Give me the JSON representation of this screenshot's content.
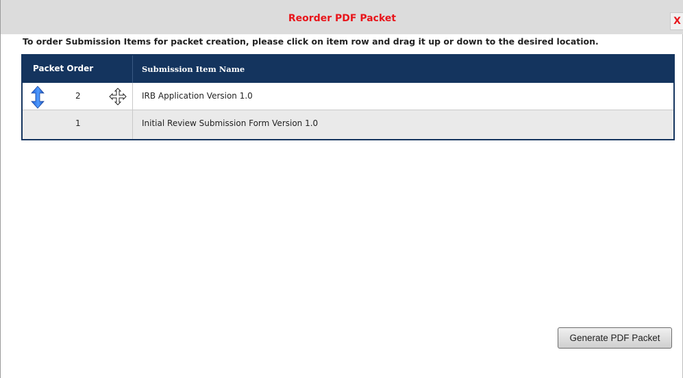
{
  "dialog": {
    "title": "Reorder PDF Packet",
    "close_label": "X",
    "instructions": "To order Submission Items for packet creation, please click on item row and drag it up or down to the desired location."
  },
  "table": {
    "columns": [
      "Packet Order",
      "Submission Item Name"
    ],
    "rows": [
      {
        "order": "2",
        "name": "IRB Application Version 1.0",
        "icons": [
          "reorder-arrow-icon",
          "move-cursor-icon"
        ]
      },
      {
        "order": "1",
        "name": "Initial Review Submission Form Version 1.0"
      }
    ]
  },
  "actions": {
    "generate_label": "Generate PDF Packet"
  },
  "colors": {
    "title_red": "#e8151b",
    "header_navy": "#14345e",
    "row_alt": "#eaeaea"
  }
}
